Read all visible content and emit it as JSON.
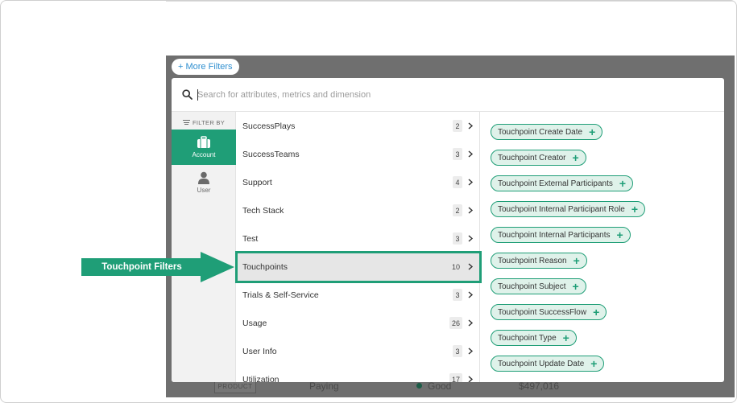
{
  "toolbar": {
    "more_filters_label": "+ More Filters"
  },
  "search": {
    "placeholder": "Search for attributes, metrics and dimension"
  },
  "rail": {
    "filter_by_label": "FILTER BY",
    "items": [
      {
        "label": "Account",
        "icon": "briefcase-icon",
        "active": true
      },
      {
        "label": "User",
        "icon": "person-icon",
        "active": false
      }
    ]
  },
  "categories": [
    {
      "label": "SuccessPlays",
      "count": "2"
    },
    {
      "label": "SuccessTeams",
      "count": "3"
    },
    {
      "label": "Support",
      "count": "4"
    },
    {
      "label": "Tech Stack",
      "count": "2"
    },
    {
      "label": "Test",
      "count": "3"
    },
    {
      "label": "Touchpoints",
      "count": "10",
      "active": true
    },
    {
      "label": "Trials & Self-Service",
      "count": "3"
    },
    {
      "label": "Usage",
      "count": "26"
    },
    {
      "label": "User Info",
      "count": "3"
    },
    {
      "label": "Utilization",
      "count": "17"
    }
  ],
  "attributes": [
    "Touchpoint Create Date",
    "Touchpoint Creator",
    "Touchpoint External Participants",
    "Touchpoint Internal Participant Role",
    "Touchpoint Internal Participants",
    "Touchpoint Reason",
    "Touchpoint Subject",
    "Touchpoint SuccessFlow",
    "Touchpoint Type",
    "Touchpoint Update Date"
  ],
  "annotation": {
    "label": "Touchpoint Filters"
  },
  "background_row": {
    "badge": "PRODUCT",
    "stage": "Paying",
    "health": "Good",
    "amount": "$497,016"
  },
  "colors": {
    "accent": "#1f9e77",
    "chip_bg": "#dff2ea",
    "link": "#2f8fd0"
  }
}
